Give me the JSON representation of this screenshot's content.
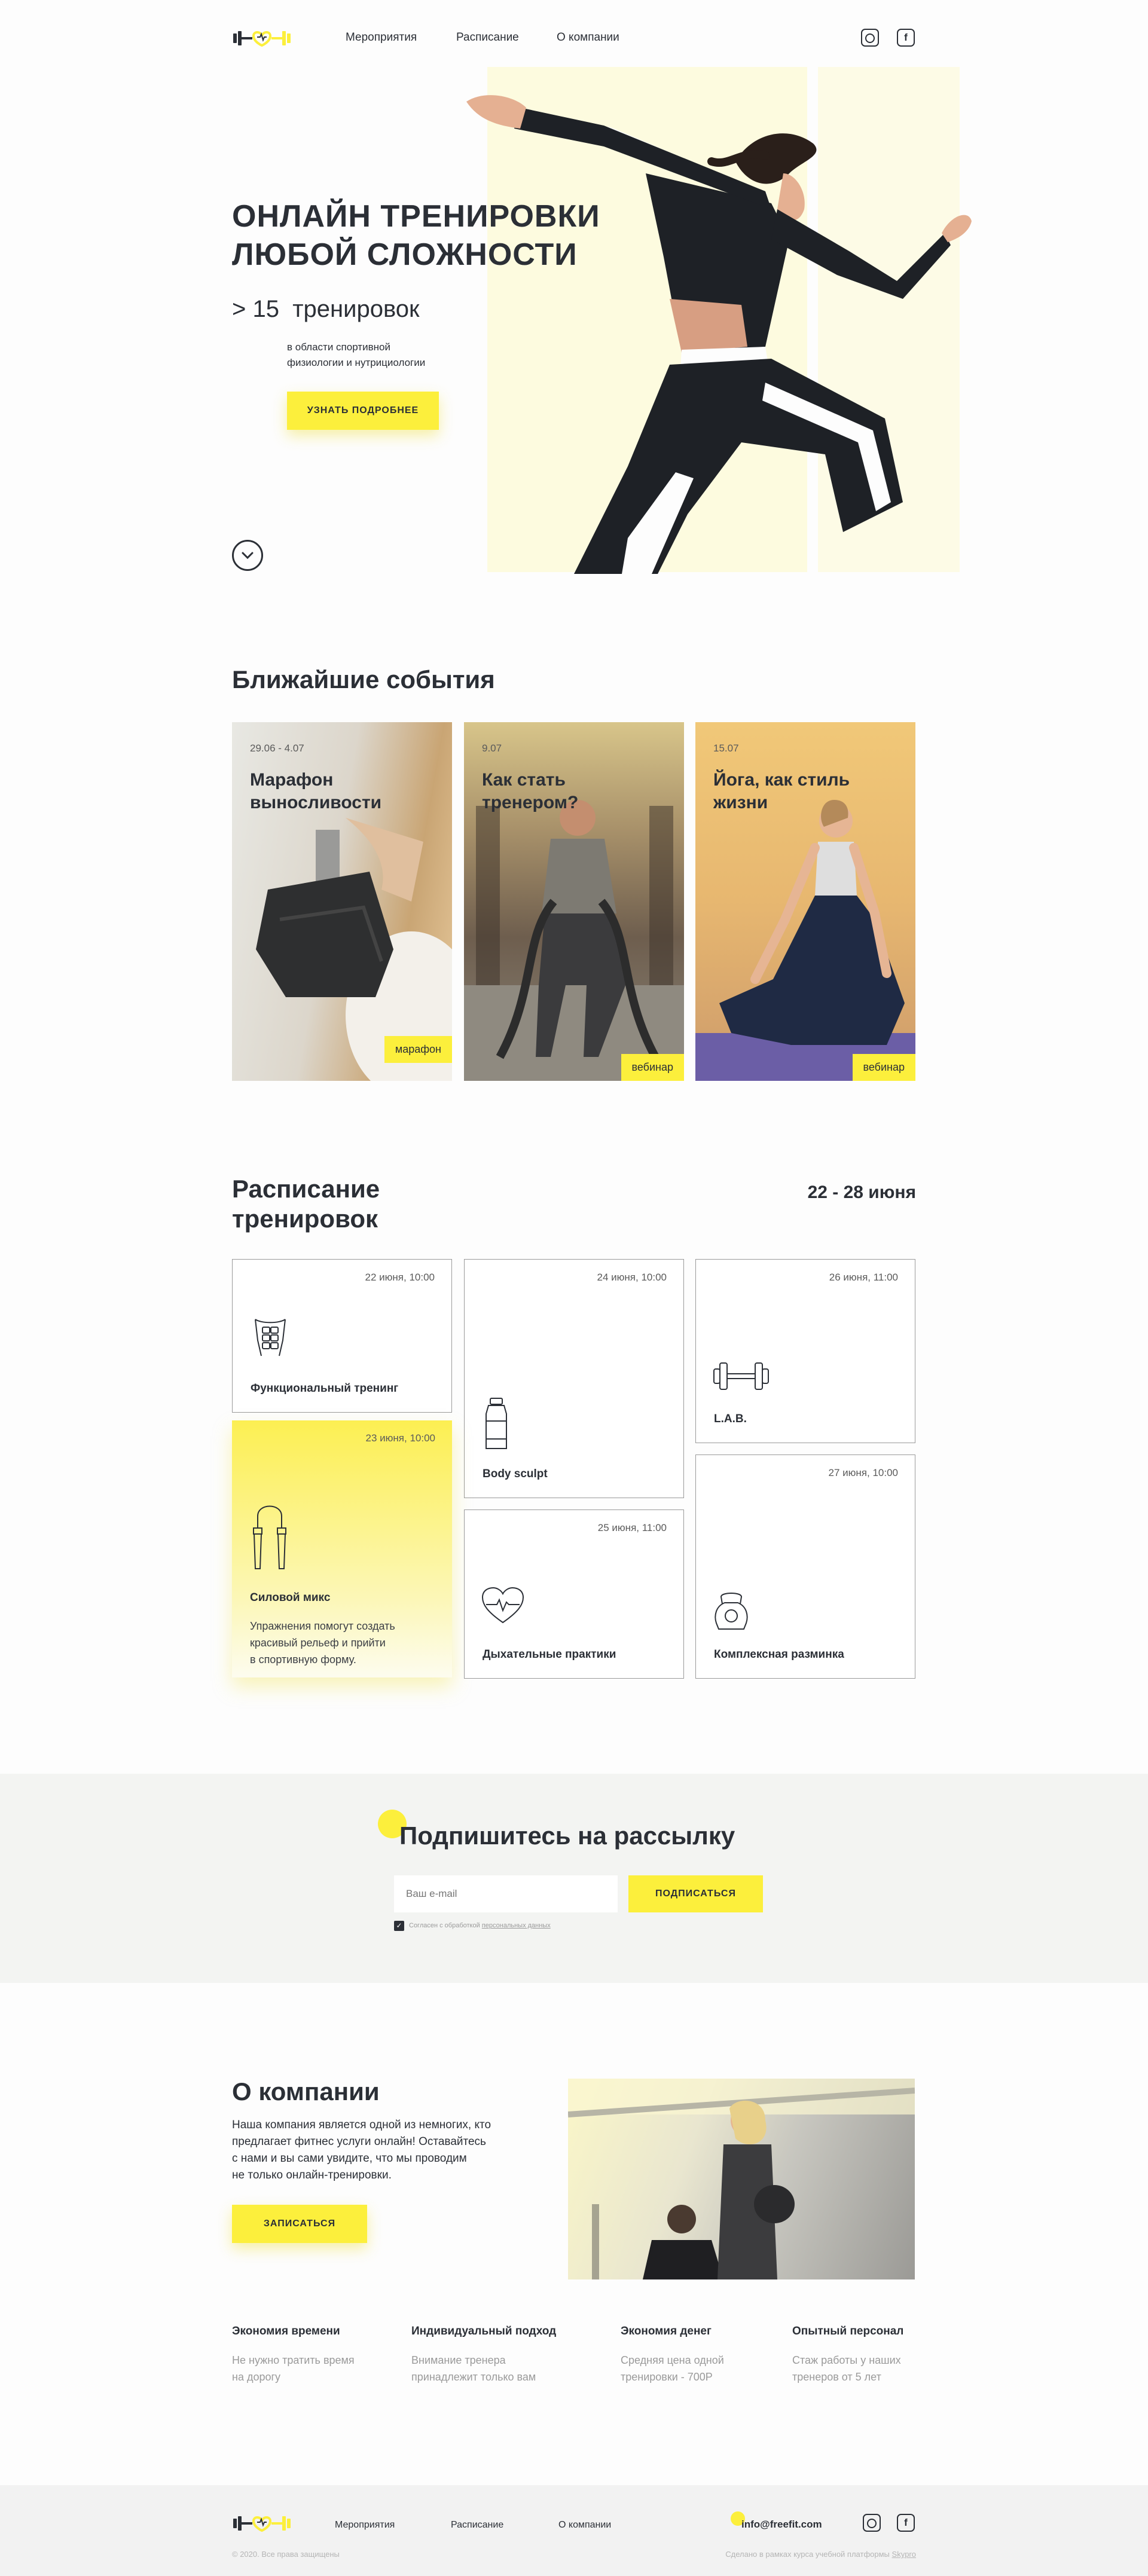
{
  "header": {
    "nav": [
      "Мероприятия",
      "Расписание",
      "О компании"
    ],
    "social": [
      "instagram-icon",
      "facebook-icon"
    ]
  },
  "hero": {
    "title_line1": "ОНЛАЙН ТРЕНИРОВКИ",
    "title_line2": "ЛЮБОЙ СЛОЖНОСТИ",
    "count_prefix": "> 15",
    "count_label": "тренировок",
    "note_line1": "в области спортивной",
    "note_line2": "физиологии и нутрициологии",
    "button": "УЗНАТЬ ПОДРОБНЕЕ"
  },
  "events": {
    "heading": "Ближайшие события",
    "cards": [
      {
        "date": "29.06 - 4.07",
        "title_line1": "Марафон",
        "title_line2": "выносливости",
        "tag": "марафон"
      },
      {
        "date": "9.07",
        "title_line1": "Как стать",
        "title_line2": "тренером?",
        "tag": "вебинар"
      },
      {
        "date": "15.07",
        "title_line1": "Йога, как стиль",
        "title_line2": "жизни",
        "tag": "вебинар"
      }
    ]
  },
  "schedule": {
    "heading_line1": "Расписание",
    "heading_line2": "тренировок",
    "range": "22 - 28 июня",
    "cards": [
      {
        "date": "22 июня, 10:00",
        "title": "Функциональный тренинг",
        "icon": "abs-icon"
      },
      {
        "date": "24 июня, 10:00",
        "title": "Body sculpt",
        "icon": "bottle-icon"
      },
      {
        "date": "26 июня, 11:00",
        "title": "L.A.B.",
        "icon": "dumbbell-icon"
      },
      {
        "date": "23 июня, 10:00",
        "title": "Силовой микс",
        "icon": "jump-rope-icon",
        "desc_line1": "Упражнения помогут создать",
        "desc_line2": "красивый рельеф и прийти",
        "desc_line3": "в спортивную форму."
      },
      {
        "date": "25 июня, 11:00",
        "title": "Дыхательные практики",
        "icon": "heart-pulse-icon"
      },
      {
        "date": "27 июня, 10:00",
        "title": "Комплексная разминка",
        "icon": "kettlebell-icon"
      }
    ]
  },
  "subscribe": {
    "heading": "Подпишитесь на рассылку",
    "placeholder": "Ваш e-mail",
    "button": "ПОДПИСАТЬСЯ",
    "consent_text": "Согласен с обработкой",
    "consent_link": "персональных данных"
  },
  "about": {
    "heading": "О компании",
    "text_line1": "Наша компания является одной из немногих, кто",
    "text_line2": "предлагает фитнес услуги онлайн! Оставайтесь",
    "text_line3": "с нами и вы сами увидите, что мы проводим",
    "text_line4": "не только онлайн-тренировки.",
    "button": "ЗАПИСАТЬСЯ"
  },
  "features": [
    {
      "title": "Экономия времени",
      "line1": "Не нужно тратить время",
      "line2": "на дорогу"
    },
    {
      "title": "Индивидуальный подход",
      "line1": "Внимание тренера",
      "line2": "принадлежит только вам"
    },
    {
      "title": "Экономия денег",
      "line1": "Средняя цена одной",
      "line2": "тренировки - 700Р"
    },
    {
      "title": "Опытный персонал",
      "line1": "Стаж работы у наших",
      "line2": "тренеров от 5 лет"
    }
  ],
  "footer": {
    "nav": [
      "Мероприятия",
      "Расписание",
      "О компании"
    ],
    "email": "info@freefit.com",
    "copyright": "© 2020. Все права защищены",
    "credit": "Сделано в рамках курса учебной платформы",
    "credit_link": "Skypro"
  },
  "colors": {
    "accent": "#fcef3c",
    "text": "#2b2f36",
    "muted": "#9a9a9a",
    "subscribe_bg": "#f3f4f2"
  }
}
